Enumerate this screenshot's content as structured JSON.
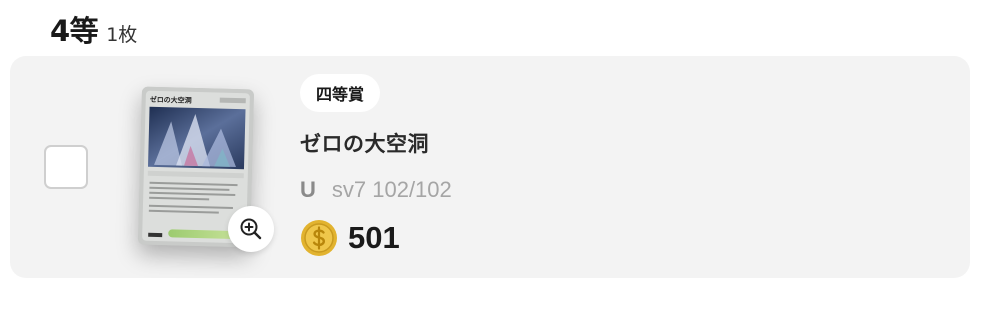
{
  "header": {
    "rank_title": "4等",
    "count_label": "1枚"
  },
  "card": {
    "prize_label": "四等賞",
    "name": "ゼロの大空洞",
    "rarity": "U",
    "set_number": "sv7 102/102",
    "price": "501",
    "thumbnail_title": "ゼロの大空洞"
  },
  "colors": {
    "row_background": "#f3f3f3",
    "coin_gold": "#e2b32f",
    "text_primary": "#1a1a1a",
    "text_muted": "#a5a5a5"
  },
  "icons": {
    "zoom": "zoom-in-icon",
    "coin": "coin-icon"
  }
}
